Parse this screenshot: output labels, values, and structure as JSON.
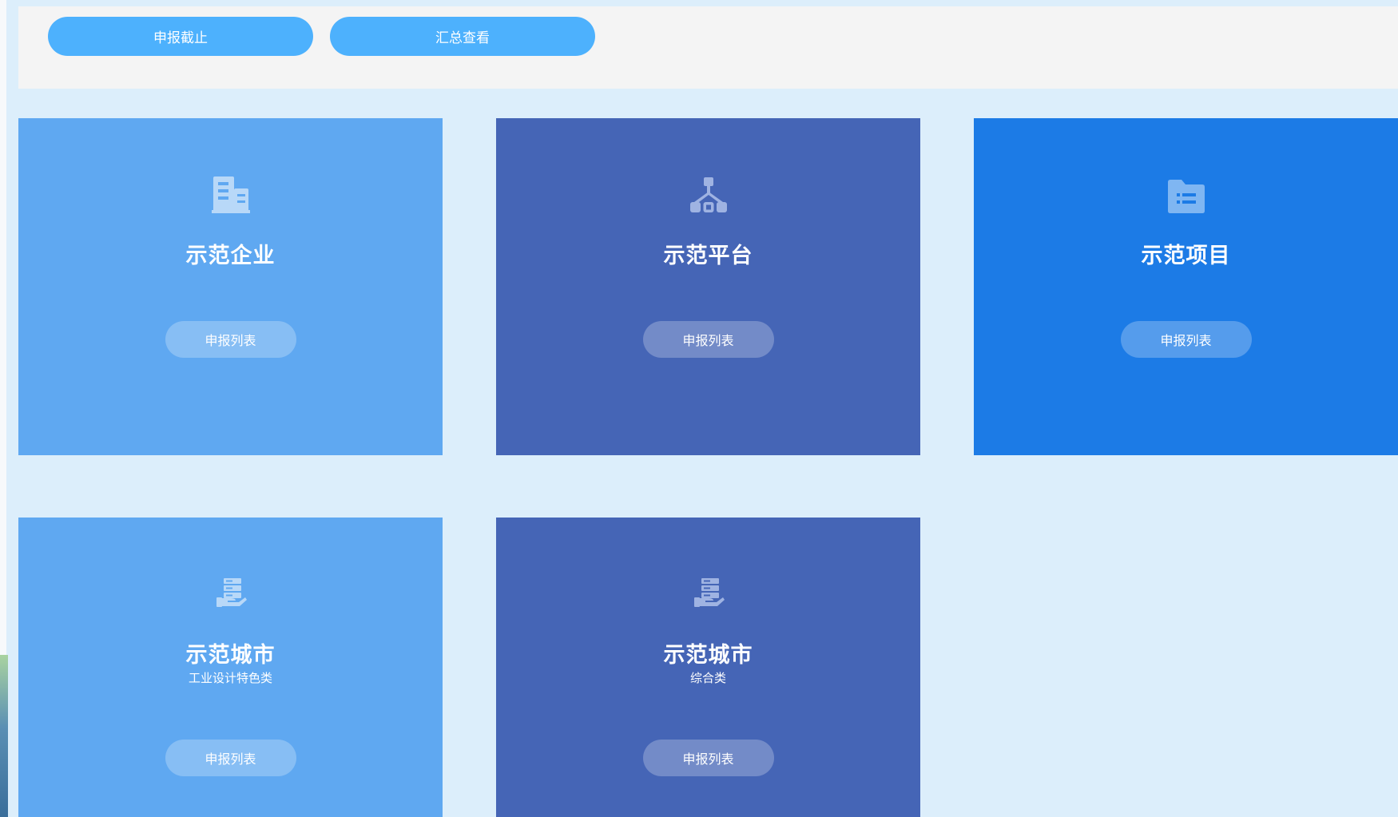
{
  "toolbar": {
    "deadline_button": "申报截止",
    "summary_button": "汇总查看"
  },
  "cards": [
    {
      "title": "示范企业",
      "subtitle": "",
      "button": "申报列表",
      "icon": "building-icon",
      "color": "#5fa8f1"
    },
    {
      "title": "示范平台",
      "subtitle": "",
      "button": "申报列表",
      "icon": "network-icon",
      "color": "#4565b6"
    },
    {
      "title": "示范项目",
      "subtitle": "",
      "button": "申报列表",
      "icon": "folder-list-icon",
      "color": "#1c7be6"
    },
    {
      "title": "示范城市",
      "subtitle": "工业设计特色类",
      "button": "申报列表",
      "icon": "server-hand-icon",
      "color": "#5fa8f1"
    },
    {
      "title": "示范城市",
      "subtitle": "综合类",
      "button": "申报列表",
      "icon": "server-hand-icon",
      "color": "#4565b6"
    }
  ],
  "colors": {
    "page_bg": "#dceefb",
    "toolbar_bg": "#f4f4f4",
    "top_button": "#4db1fd"
  }
}
